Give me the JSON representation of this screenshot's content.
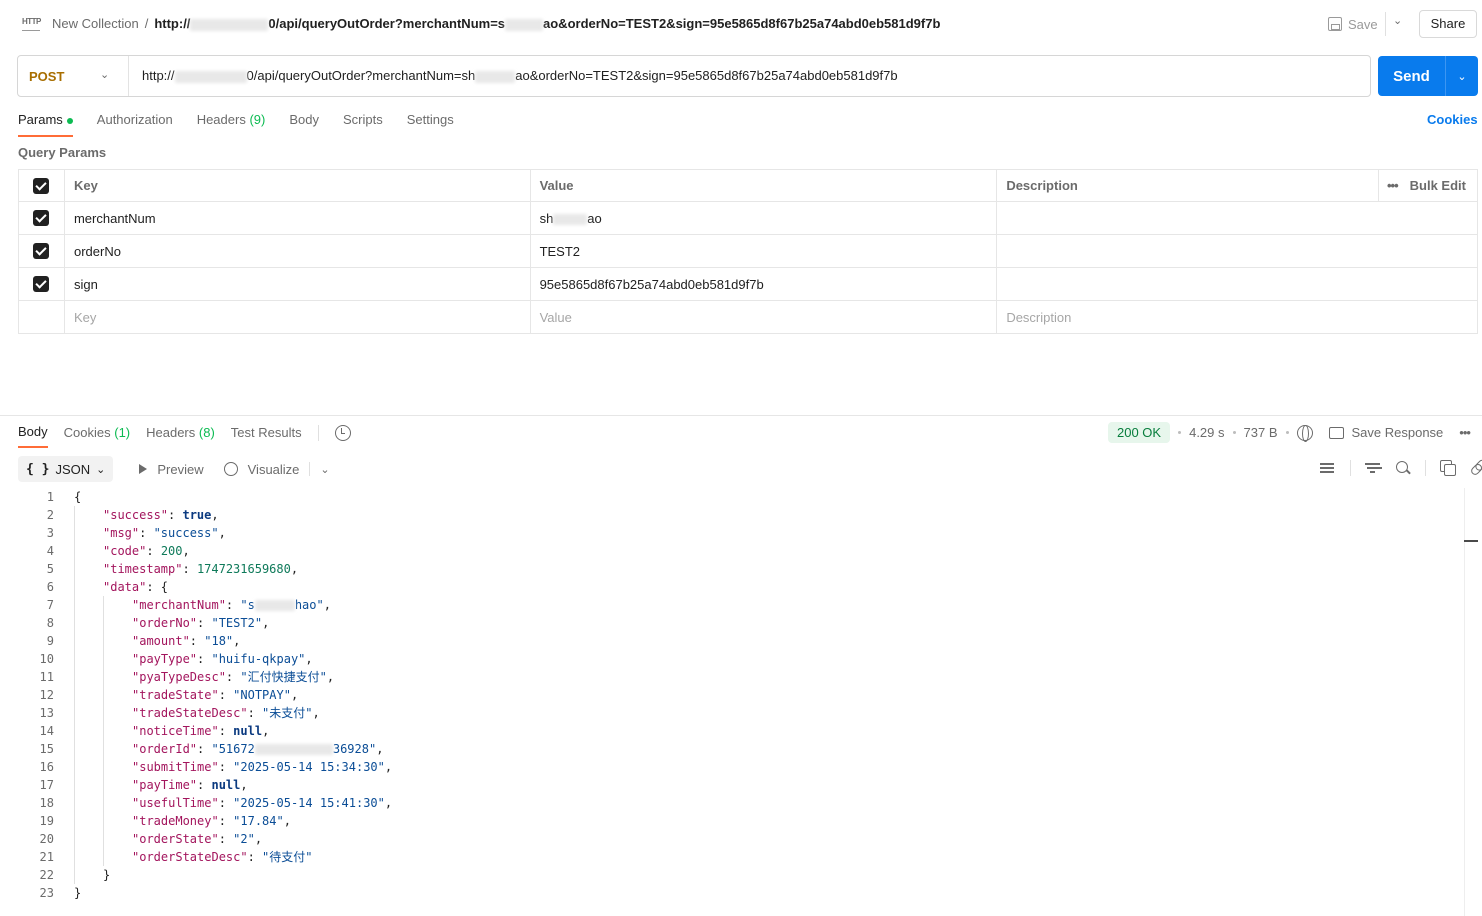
{
  "header": {
    "breadcrumb_parent": "New Collection",
    "breadcrumb_sep": "/",
    "title_prefix": "http://",
    "title_middle": "0/api/queryOutOrder?merchantNum=s",
    "title_suffix": "ao&orderNo=TEST2&sign=95e5865d8f67b25a74abd0eb581d9f7b",
    "save_label": "Save",
    "share_label": "Share"
  },
  "request": {
    "method": "POST",
    "url_prefix": "http://",
    "url_middle": "0/api/queryOutOrder?merchantNum=sh",
    "url_suffix": "ao&orderNo=TEST2&sign=95e5865d8f67b25a74abd0eb581d9f7b",
    "send_label": "Send"
  },
  "request_tabs": {
    "params": "Params",
    "authorization": "Authorization",
    "headers": "Headers",
    "headers_count": "(9)",
    "body": "Body",
    "scripts": "Scripts",
    "settings": "Settings",
    "cookies": "Cookies"
  },
  "query_params": {
    "title": "Query Params",
    "headers": {
      "key": "Key",
      "value": "Value",
      "description": "Description",
      "bulk_edit": "Bulk Edit"
    },
    "rows": [
      {
        "key": "merchantNum",
        "value_start": "sh",
        "value_end": "ao",
        "description": ""
      },
      {
        "key": "orderNo",
        "value": "TEST2",
        "description": ""
      },
      {
        "key": "sign",
        "value": "95e5865d8f67b25a74abd0eb581d9f7b",
        "description": ""
      }
    ],
    "placeholders": {
      "key": "Key",
      "value": "Value",
      "description": "Description"
    }
  },
  "response_tabs": {
    "body": "Body",
    "cookies": "Cookies",
    "cookies_count": "(1)",
    "headers": "Headers",
    "headers_count": "(8)",
    "test_results": "Test Results"
  },
  "response_status": {
    "status": "200 OK",
    "time": "4.29 s",
    "size": "737 B",
    "save_response": "Save Response"
  },
  "format_bar": {
    "format": "JSON",
    "braces": "{ }",
    "preview": "Preview",
    "visualize": "Visualize"
  },
  "response_lines": [
    "1",
    "2",
    "3",
    "4",
    "5",
    "6",
    "7",
    "8",
    "9",
    "10",
    "11",
    "12",
    "13",
    "14",
    "15",
    "16",
    "17",
    "18",
    "19",
    "20",
    "21",
    "22",
    "23"
  ],
  "response_body": {
    "success_key": "\"success\"",
    "success_val": "true",
    "msg_key": "\"msg\"",
    "msg_val": "\"success\"",
    "code_key": "\"code\"",
    "code_val": "200",
    "timestamp_key": "\"timestamp\"",
    "timestamp_val": "1747231659680",
    "data_key": "\"data\"",
    "merchantNum_key": "\"merchantNum\"",
    "merchantNum_start": "\"s",
    "merchantNum_end": "hao\"",
    "orderNo_key": "\"orderNo\"",
    "orderNo_val": "\"TEST2\"",
    "amount_key": "\"amount\"",
    "amount_val": "\"18\"",
    "payType_key": "\"payType\"",
    "payType_val": "\"huifu-qkpay\"",
    "pyaTypeDesc_key": "\"pyaTypeDesc\"",
    "pyaTypeDesc_val": "\"汇付快捷支付\"",
    "tradeState_key": "\"tradeState\"",
    "tradeState_val": "\"NOTPAY\"",
    "tradeStateDesc_key": "\"tradeStateDesc\"",
    "tradeStateDesc_val": "\"未支付\"",
    "noticeTime_key": "\"noticeTime\"",
    "noticeTime_val": "null",
    "orderId_key": "\"orderId\"",
    "orderId_start": "\"51672",
    "orderId_end": "36928\"",
    "submitTime_key": "\"submitTime\"",
    "submitTime_val": "\"2025-05-14 15:34:30\"",
    "payTime_key": "\"payTime\"",
    "payTime_val": "null",
    "usefulTime_key": "\"usefulTime\"",
    "usefulTime_val": "\"2025-05-14 15:41:30\"",
    "tradeMoney_key": "\"tradeMoney\"",
    "tradeMoney_val": "\"17.84\"",
    "orderState_key": "\"orderState\"",
    "orderState_val": "\"2\"",
    "orderStateDesc_key": "\"orderStateDesc\"",
    "orderStateDesc_val": "\"待支付\""
  },
  "colors": {
    "accent": "#097bed",
    "method": "#a86e00",
    "active_tab": "#ff6c37",
    "status_ok": "#077d3c"
  }
}
